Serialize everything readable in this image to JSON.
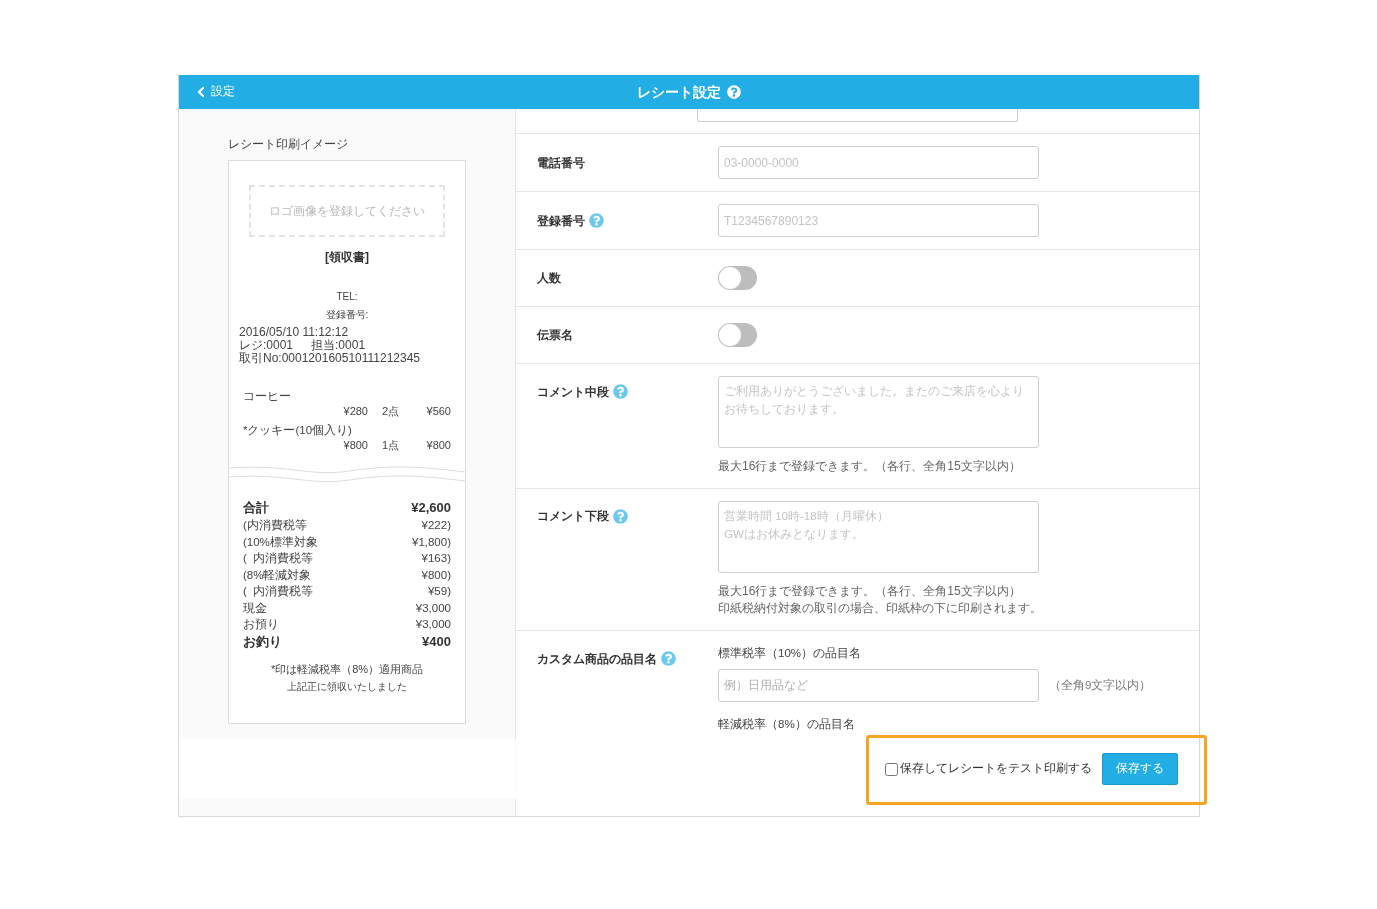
{
  "header": {
    "back_label": "設定",
    "title": "レシート設定",
    "help": true
  },
  "preview": {
    "title": "レシート印刷イメージ",
    "receipt": {
      "logo_placeholder": "ロゴ画像を登録してください",
      "heading": "[領収書]",
      "tel": "TEL:",
      "registration": "登録番号:",
      "meta": [
        [
          "2016/05/10 11:12:12"
        ],
        [
          "レジ:0001",
          "担当:0001"
        ],
        [
          "取引No:000120160510111212345"
        ]
      ],
      "items": [
        {
          "name": "コーヒー",
          "price": "¥280",
          "qty": "2点",
          "amount": "¥560"
        },
        {
          "name": "*クッキー(10個入り)",
          "price": "¥800",
          "qty": "1点",
          "amount": "¥800"
        }
      ],
      "totals": [
        {
          "label": "合計",
          "value": "¥2,600",
          "bold": true
        },
        {
          "label": "(内消費税等",
          "value": "¥222)",
          "bold": false
        },
        {
          "label": "(10%標準対象",
          "value": "¥1,800)",
          "bold": false
        },
        {
          "label": "(  内消費税等",
          "value": "¥163)",
          "bold": false
        },
        {
          "label": "(8%軽減対象",
          "value": "¥800)",
          "bold": false
        },
        {
          "label": "(  内消費税等",
          "value": "¥59)",
          "bold": false
        },
        {
          "label": "現金",
          "value": "¥3,000",
          "bold": false
        },
        {
          "label": "お預り",
          "value": "¥3,000",
          "bold": false
        },
        {
          "label": "お釣り",
          "value": "¥400",
          "bold": true
        }
      ],
      "note": "*印は軽減税率（8%）適用商品",
      "thanks": "上記正に領収いたしました"
    }
  },
  "form": {
    "rows": [
      {
        "kind": "input",
        "label": "電話番号",
        "help": false,
        "placeholder": "03-0000-0000"
      },
      {
        "kind": "input",
        "label": "登録番号",
        "help": true,
        "placeholder": "T1234567890123"
      },
      {
        "kind": "toggle",
        "label": "人数",
        "help": false,
        "on": false
      },
      {
        "kind": "toggle",
        "label": "伝票名",
        "help": false,
        "on": false
      },
      {
        "kind": "textarea",
        "label": "コメント中段",
        "help": true,
        "placeholder": "ご利用ありがとうございました。またのご来店を心よりお待ちしております。",
        "notes": [
          "最大16行まで登録できます。（各行、全角15文字以内）"
        ]
      },
      {
        "kind": "textarea",
        "label": "コメント下段",
        "help": true,
        "placeholder": "営業時間 10時-18時（月曜休）\nGWはお休みとなります。",
        "notes": [
          "最大16行まで登録できます。（各行、全角15文字以内）",
          "印紙税納付対象の取引の場合、印紙枠の下に印刷されます。"
        ]
      },
      {
        "kind": "custom",
        "label": "カスタム商品の品目名",
        "help": true,
        "fields": [
          {
            "label": "標準税率（10%）の品目名",
            "placeholder": "例）日用品など",
            "hint": "（全角9文字以内）"
          },
          {
            "label": "軽減税率（8%）の品目名"
          }
        ]
      }
    ]
  },
  "footer": {
    "checkbox": {
      "label": "保存してレシートをテスト印刷する",
      "checked": false
    },
    "save_button": "保存する"
  }
}
